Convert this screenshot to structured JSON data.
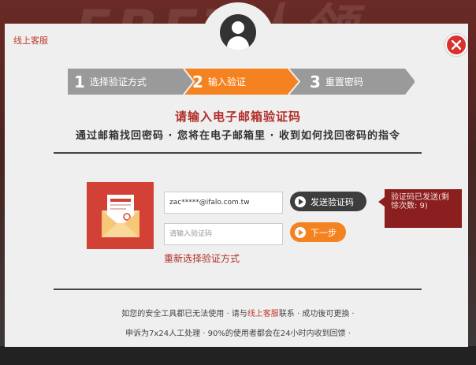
{
  "header": {
    "customer_service_link": "线上客服"
  },
  "steps": [
    {
      "number": "1",
      "label": "选择验证方式",
      "state": "done"
    },
    {
      "number": "2",
      "label": "输入验证",
      "state": "active"
    },
    {
      "number": "3",
      "label": "重置密码",
      "state": "pending"
    }
  ],
  "main": {
    "title": "请输入电子邮箱验证码",
    "subtitle": "通过邮箱找回密码 · 您将在电子邮箱里 · 收到如何找回密码的指令",
    "email_value": "zac*****@ifalo.com.tw",
    "code_placeholder": "请输入验证码",
    "send_code_label": "发送验证码",
    "next_label": "下一步",
    "reselect_label": "重新选择验证方式",
    "tip_text": "验证码已发送(剩馀次数: 9)"
  },
  "footer": {
    "line1_before": "如您的安全工具都已无法使用 · 请与",
    "line1_link": "线上客服",
    "line1_after": "联系 · 成功後可更換 ·",
    "line2": "申诉为7x24人工处理 · 90%的使用者都会在24小时内收到回馈 ·"
  },
  "colors": {
    "accent_orange": "#f58220",
    "step_gray": "#9a9a9a",
    "brand_red": "#b22f2a",
    "dark_button": "#3d3d3d"
  }
}
